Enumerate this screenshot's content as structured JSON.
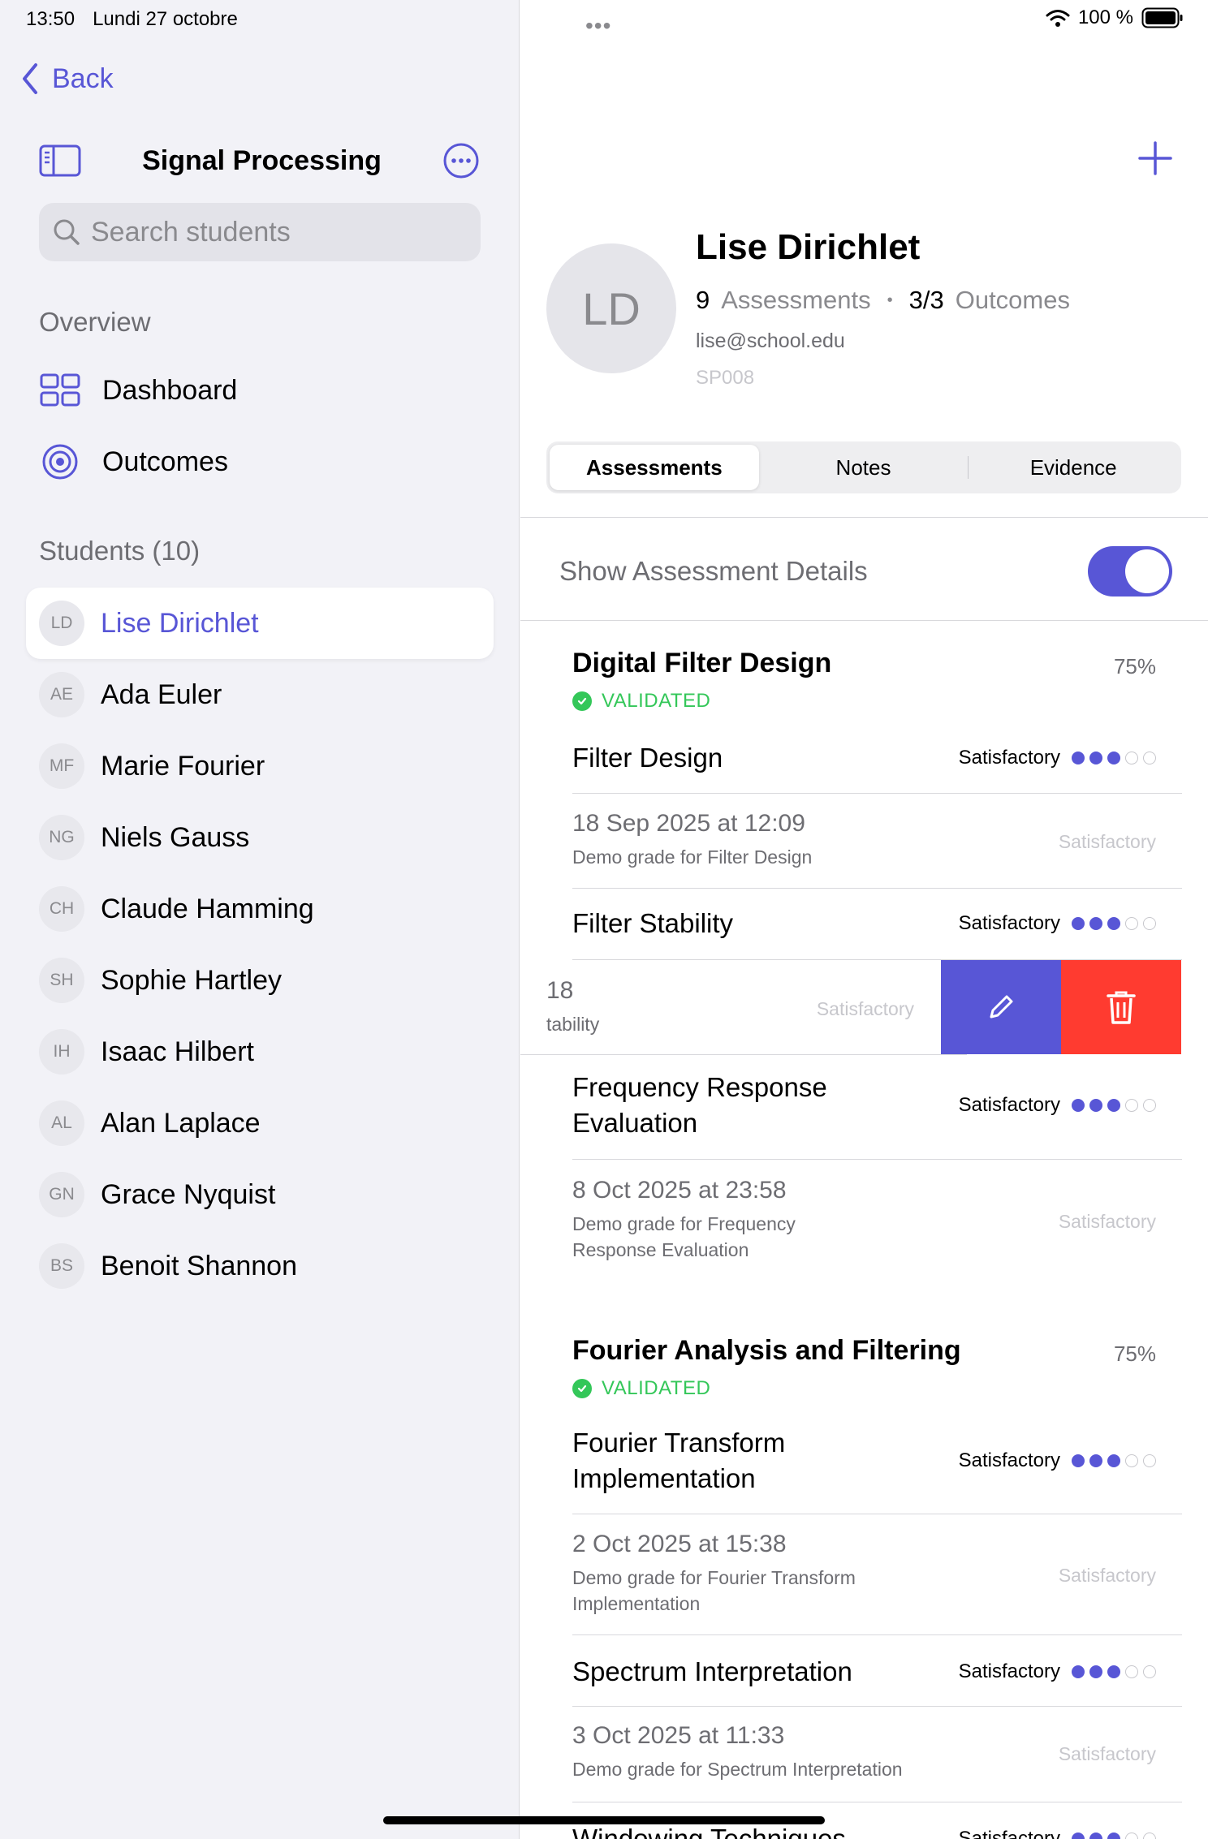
{
  "status_bar": {
    "time": "13:50",
    "date": "Lundi 27 octobre",
    "battery": "100 %"
  },
  "sidebar": {
    "back_label": "Back",
    "title": "Signal Processing",
    "search_placeholder": "Search students",
    "overview_title": "Overview",
    "overview_items": [
      {
        "label": "Dashboard",
        "icon": "grid-icon"
      },
      {
        "label": "Outcomes",
        "icon": "target-icon"
      }
    ],
    "students_title": "Students (10)",
    "students": [
      {
        "initials": "LD",
        "name": "Lise Dirichlet",
        "active": true
      },
      {
        "initials": "AE",
        "name": "Ada Euler"
      },
      {
        "initials": "MF",
        "name": "Marie Fourier"
      },
      {
        "initials": "NG",
        "name": "Niels Gauss"
      },
      {
        "initials": "CH",
        "name": "Claude Hamming"
      },
      {
        "initials": "SH",
        "name": "Sophie Hartley"
      },
      {
        "initials": "IH",
        "name": "Isaac Hilbert"
      },
      {
        "initials": "AL",
        "name": "Alan Laplace"
      },
      {
        "initials": "GN",
        "name": "Grace Nyquist"
      },
      {
        "initials": "BS",
        "name": "Benoit Shannon"
      }
    ]
  },
  "profile": {
    "initials": "LD",
    "name": "Lise Dirichlet",
    "assessments_count": "9",
    "assessments_label": "Assessments",
    "outcomes_count": "3/3",
    "outcomes_label": "Outcomes",
    "email": "lise@school.edu",
    "student_id": "SP008"
  },
  "tabs": [
    "Assessments",
    "Notes",
    "Evidence"
  ],
  "toggle": {
    "label": "Show Assessment Details",
    "on": true
  },
  "colors": {
    "accent": "#5856d6",
    "validated": "#34c759",
    "delete": "#ff3b30"
  },
  "groups": [
    {
      "title": "Digital Filter Design",
      "percent": "75%",
      "status": "VALIDATED",
      "outcomes": [
        {
          "name": "Filter Design",
          "level": "Satisfactory",
          "rating": 3,
          "max": 5,
          "grade": {
            "date": "18 Sep 2025 at 12:09",
            "desc": "Demo grade for Filter Design",
            "level": "Satisfactory"
          }
        },
        {
          "name": "Filter Stability",
          "level": "Satisfactory",
          "rating": 3,
          "max": 5,
          "grade": {
            "date": "18",
            "desc": "tability",
            "level": "Satisfactory"
          }
        },
        {
          "name": "Frequency Response Evaluation",
          "level": "Satisfactory",
          "rating": 3,
          "max": 5,
          "grade": {
            "date": "8 Oct 2025 at 23:58",
            "desc": "Demo grade for Frequency Response Evaluation",
            "level": "Satisfactory"
          }
        }
      ]
    },
    {
      "title": "Fourier Analysis and Filtering",
      "percent": "75%",
      "status": "VALIDATED",
      "outcomes": [
        {
          "name": "Fourier Transform Implementation",
          "level": "Satisfactory",
          "rating": 3,
          "max": 5,
          "grade": {
            "date": "2 Oct 2025 at 15:38",
            "desc": "Demo grade for Fourier Transform Implementation",
            "level": "Satisfactory"
          }
        },
        {
          "name": "Spectrum Interpretation",
          "level": "Satisfactory",
          "rating": 3,
          "max": 5,
          "grade": {
            "date": "3 Oct 2025 at 11:33",
            "desc": "Demo grade for Spectrum Interpretation",
            "level": "Satisfactory"
          }
        },
        {
          "name": "Windowing Techniques",
          "level": "Satisfactory",
          "rating": 3,
          "max": 5
        }
      ]
    }
  ]
}
